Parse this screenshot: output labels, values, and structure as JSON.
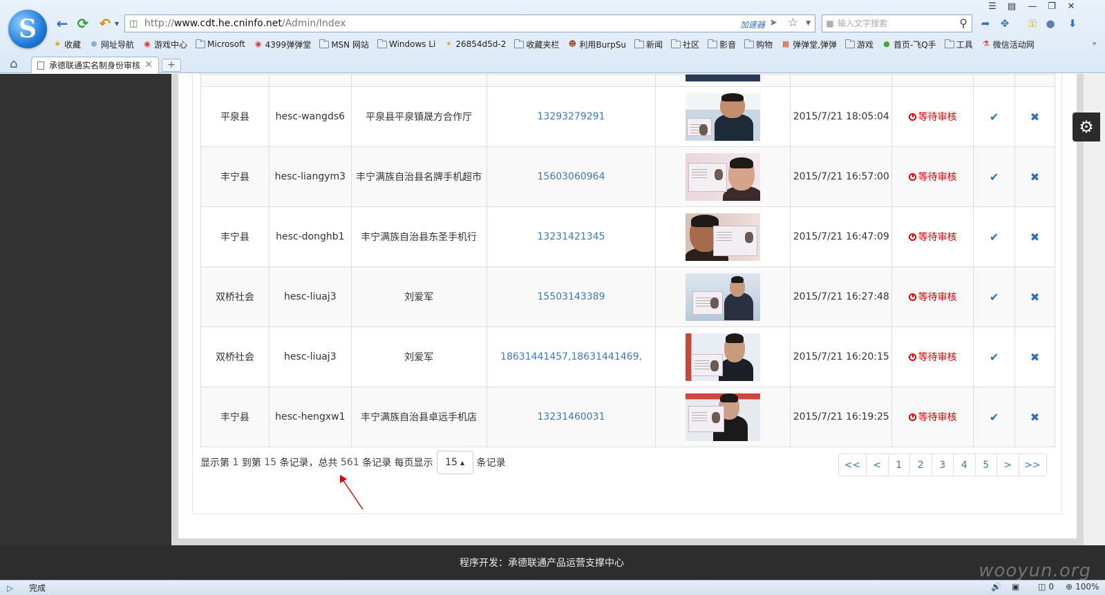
{
  "browser": {
    "address_prefix": "http://",
    "address_host": "www.cdt.he.cninfo.net",
    "address_path": "/Admin/Index",
    "accelerator_label": "加速器",
    "search_placeholder": "输入文字搜索",
    "bookmarks": [
      {
        "label": "收藏",
        "icon": "star-icon"
      },
      {
        "label": "网址导航",
        "icon": "globe-icon"
      },
      {
        "label": "游戏中心",
        "icon": "game-icon"
      },
      {
        "label": "Microsoft",
        "icon": "folder-icon"
      },
      {
        "label": "4399弹弹堂",
        "icon": "game-icon"
      },
      {
        "label": "MSN 网站",
        "icon": "folder-icon"
      },
      {
        "label": "Windows Li",
        "icon": "folder-icon"
      },
      {
        "label": "26854d5d-2",
        "icon": "star-badge-icon"
      },
      {
        "label": "收藏夹栏",
        "icon": "folder-icon"
      },
      {
        "label": "利用BurpSu",
        "icon": "avatar-icon"
      },
      {
        "label": "新闻",
        "icon": "folder-icon"
      },
      {
        "label": "社区",
        "icon": "folder-icon"
      },
      {
        "label": "影音",
        "icon": "folder-icon"
      },
      {
        "label": "购物",
        "icon": "folder-icon"
      },
      {
        "label": "弹弹堂,弹弹",
        "icon": "grid-icon"
      },
      {
        "label": "游戏",
        "icon": "folder-icon"
      },
      {
        "label": "首页-飞Q手",
        "icon": "fruit-icon"
      },
      {
        "label": "工具",
        "icon": "folder-icon"
      },
      {
        "label": "微信活动网",
        "icon": "person-icon"
      }
    ],
    "tab_title": "承德联通实名制身份审核",
    "new_tab_label": "+",
    "status_text": "完成",
    "status_count": "0",
    "zoom": "100%",
    "watermark": "wooyun.org"
  },
  "table": {
    "rows": [
      {
        "county": "平泉县",
        "account": "hesc-wangds6",
        "store": "平泉县平泉镇晟方合作厅",
        "phone": "13293279291",
        "time": "2015/7/21 18:05:04",
        "status": "等待审核",
        "photo": 0
      },
      {
        "county": "丰宁县",
        "account": "hesc-liangym3",
        "store": "丰宁满族自治县名牌手机超市",
        "phone": "15603060964",
        "time": "2015/7/21 16:57:00",
        "status": "等待审核",
        "photo": 1
      },
      {
        "county": "丰宁县",
        "account": "hesc-donghb1",
        "store": "丰宁满族自治县东圣手机行",
        "phone": "13231421345",
        "time": "2015/7/21 16:47:09",
        "status": "等待审核",
        "photo": 2
      },
      {
        "county": "双桥社会",
        "account": "hesc-liuaj3",
        "store": "刘爱军",
        "phone": "15503143389",
        "time": "2015/7/21 16:27:48",
        "status": "等待审核",
        "photo": 3
      },
      {
        "county": "双桥社会",
        "account": "hesc-liuaj3",
        "store": "刘爱军",
        "phone": "18631441457,18631441469,",
        "time": "2015/7/21 16:20:15",
        "status": "等待审核",
        "photo": 4
      },
      {
        "county": "丰宁县",
        "account": "hesc-hengxw1",
        "store": "丰宁满族自治县卓远手机店",
        "phone": "13231460031",
        "time": "2015/7/21 16:19:25",
        "status": "等待审核",
        "photo": 5
      }
    ]
  },
  "pager": {
    "text_1": "显示第",
    "from": "1",
    "text_2": "到第",
    "to": "15",
    "text_3": "条记录，总共",
    "total": "561",
    "text_4": "条记录 每页显示",
    "page_size": "15",
    "text_5": "条记录",
    "buttons": [
      "<<",
      "<",
      "1",
      "2",
      "3",
      "4",
      "5",
      ">",
      ">>"
    ]
  },
  "footer": {
    "text": "程序开发：承德联通产品运营支撑中心"
  },
  "colors": {
    "status_red": "#e00000",
    "link_blue": "#3a7ab8",
    "annotation_red": "#e00000"
  }
}
